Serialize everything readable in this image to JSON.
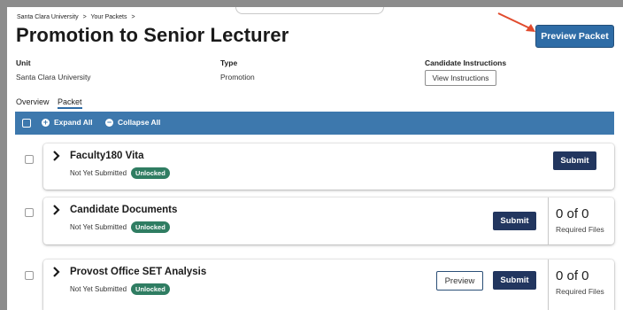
{
  "breadcrumb": [
    "Santa Clara University",
    ">",
    "Your Packets",
    ">"
  ],
  "page_title": "Promotion to Senior Lecturer",
  "header": {
    "preview_packet_label": "Preview Packet",
    "arrow_color": "#e14b2d"
  },
  "meta": {
    "unit_label": "Unit",
    "unit_value": "Santa Clara University",
    "type_label": "Type",
    "type_value": "Promotion",
    "instructions_label": "Candidate Instructions",
    "view_instructions_label": "View Instructions"
  },
  "tabs": [
    {
      "label": "Overview",
      "active": false
    },
    {
      "label": "Packet",
      "active": true
    }
  ],
  "toolbar": {
    "expand_label": "Expand All",
    "collapse_label": "Collapse All",
    "expand_icon": "plus-circle-icon",
    "collapse_icon": "minus-circle-icon"
  },
  "sections": [
    {
      "title": "Faculty180 Vita",
      "status": "Not Yet Submitted",
      "badge": "Unlocked",
      "submit_label": "Submit"
    },
    {
      "title": "Candidate Documents",
      "status": "Not Yet Submitted",
      "badge": "Unlocked",
      "submit_label": "Submit",
      "required_count": "0 of 0",
      "required_label": "Required Files"
    },
    {
      "title": "Provost Office SET Analysis",
      "status": "Not Yet Submitted",
      "badge": "Unlocked",
      "preview_label": "Preview",
      "submit_label": "Submit",
      "required_count": "0 of 0",
      "required_label": "Required Files"
    }
  ],
  "colors": {
    "primary": "#2e6ca6",
    "toolbar": "#3d78ad",
    "submit": "#22365f",
    "badge": "#2f7d62"
  }
}
